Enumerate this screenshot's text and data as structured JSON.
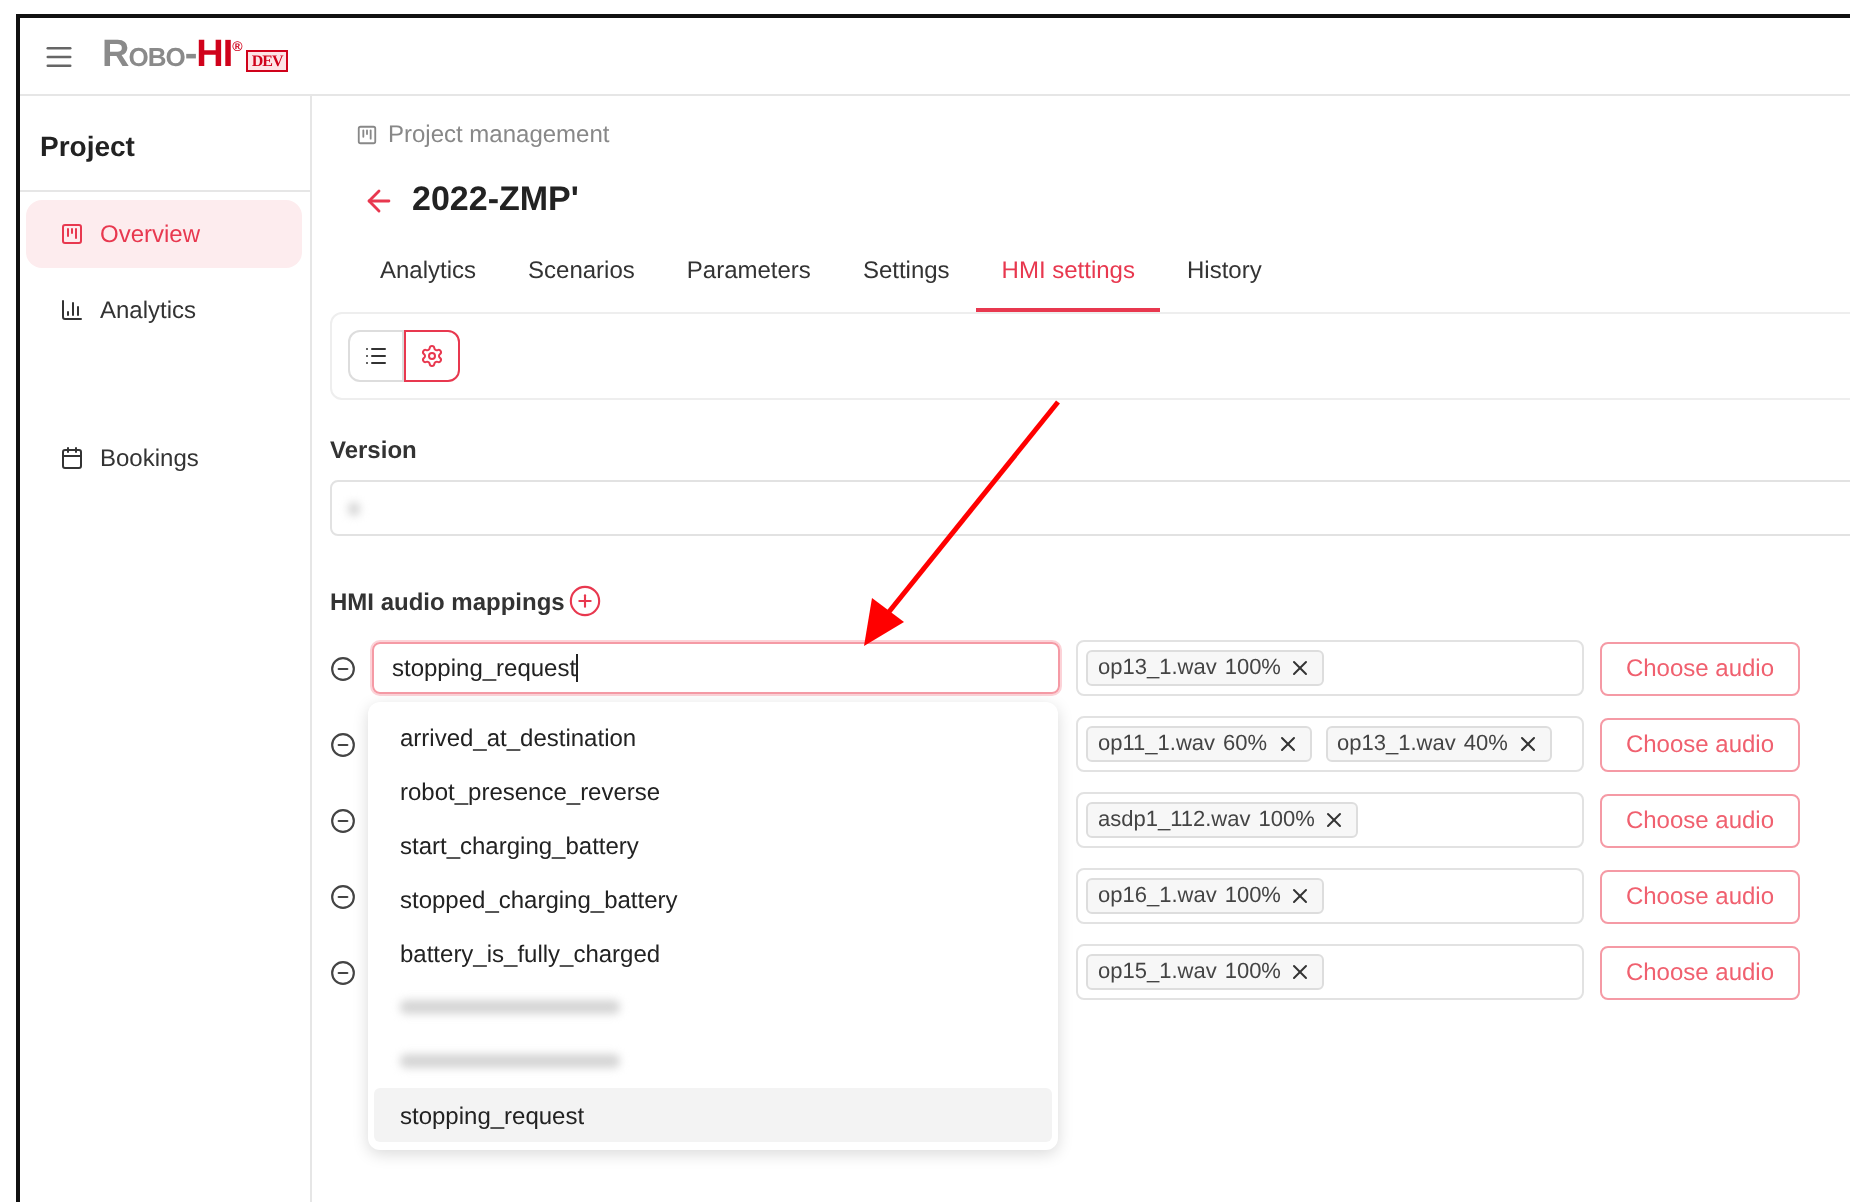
{
  "app": {
    "logo_main": "Robo-",
    "logo_accent": "HI",
    "logo_mark": "®",
    "env_badge": "DEV"
  },
  "sidebar": {
    "title": "Project",
    "items": [
      {
        "label": "Overview",
        "kind": "board",
        "selected": true
      },
      {
        "label": "Analytics",
        "kind": "chart",
        "selected": false
      },
      {
        "label": "Bookings",
        "kind": "calendar",
        "selected": false
      }
    ]
  },
  "breadcrumb": "Project management",
  "page_title": "2022-ZMP'",
  "tabs": [
    {
      "label": "Analytics",
      "selected": false
    },
    {
      "label": "Scenarios",
      "selected": false
    },
    {
      "label": "Parameters",
      "selected": false
    },
    {
      "label": "Settings",
      "selected": false
    },
    {
      "label": "HMI settings",
      "selected": true
    },
    {
      "label": "History",
      "selected": false
    }
  ],
  "view_toggle": [
    {
      "kind": "list",
      "selected": false
    },
    {
      "kind": "gear",
      "selected": true
    }
  ],
  "version": {
    "label": "Version",
    "value_redacted": true
  },
  "audio_mappings": {
    "title": "HMI audio mappings",
    "rows": [
      {
        "event": "stopping_request",
        "focused": true,
        "clips": [
          {
            "file": "op13_1.wav",
            "share": "100%"
          }
        ],
        "button": "Choose audio"
      },
      {
        "clips": [
          {
            "file": "op11_1.wav",
            "share": "60%"
          },
          {
            "file": "op13_1.wav",
            "share": "40%"
          }
        ],
        "button": "Choose audio"
      },
      {
        "clips": [
          {
            "file": "asdp1_112.wav",
            "share": "100%"
          }
        ],
        "button": "Choose audio"
      },
      {
        "clips": [
          {
            "file": "op16_1.wav",
            "share": "100%"
          }
        ],
        "button": "Choose audio"
      },
      {
        "clips": [
          {
            "file": "op15_1.wav",
            "share": "100%"
          }
        ],
        "button": "Choose audio"
      }
    ]
  },
  "dropdown": {
    "options": [
      {
        "kind": "text",
        "label": "arrived_at_destination",
        "selected": false
      },
      {
        "kind": "text",
        "label": "robot_presence_reverse",
        "selected": false
      },
      {
        "kind": "text",
        "label": "start_charging_battery",
        "selected": false
      },
      {
        "kind": "text",
        "label": "stopped_charging_battery",
        "selected": false
      },
      {
        "kind": "text",
        "label": "battery_is_fully_charged",
        "selected": false
      },
      {
        "kind": "redacted",
        "selected": false
      },
      {
        "kind": "redacted",
        "selected": false
      },
      {
        "kind": "text",
        "label": "stopping_request",
        "selected": true
      }
    ]
  }
}
